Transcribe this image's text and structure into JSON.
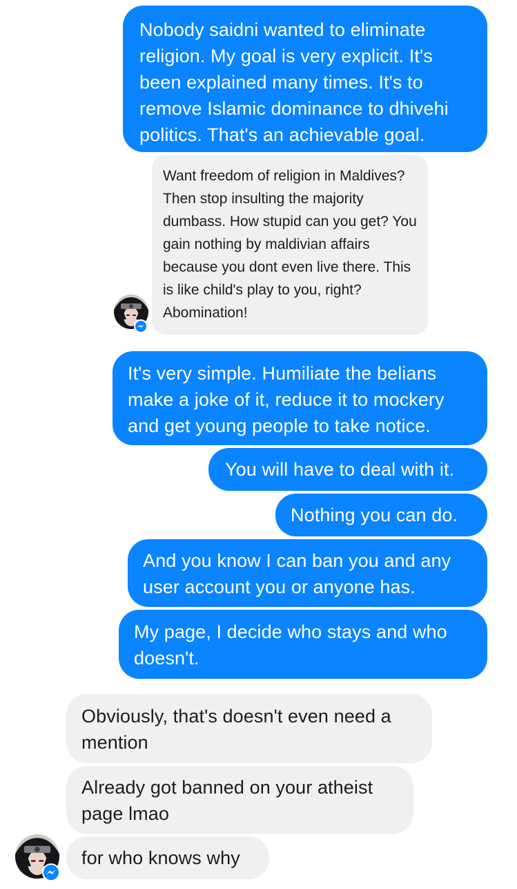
{
  "conversation": {
    "messages": [
      {
        "sender": "me",
        "text": "Nobody saidni wanted to eliminate religion. My goal is very explicit. It's been explained many times. It's to remove Islamic dominance to dhivehi politics. That's an achievable goal."
      },
      {
        "sender": "other",
        "type": "quoted-image",
        "text": "Want freedom of religion in Maldives? Then stop insulting the majority dumbass. How stupid can you get? You gain nothing by maldivian affairs because you dont even live there. This is like child's play to you, right? Abomination!"
      },
      {
        "sender": "me",
        "text": "It's very simple. Humiliate the belians make a joke of it, reduce it to mockery and get young people to take notice."
      },
      {
        "sender": "me",
        "text": "You will have to deal with it."
      },
      {
        "sender": "me",
        "text": "Nothing you can do."
      },
      {
        "sender": "me",
        "text": "And you know I can ban you and any user account you or anyone has."
      },
      {
        "sender": "me",
        "text": "My page, I decide who stays and who doesn't."
      },
      {
        "sender": "other",
        "text": "Obviously, that's doesn't even need a mention"
      },
      {
        "sender": "other",
        "text": "Already got banned on your atheist page lmao"
      },
      {
        "sender": "other",
        "text": "for who knows why"
      }
    ]
  },
  "avatar": {
    "icon": "anime-avatar-icon",
    "badge_icon": "messenger-badge-icon"
  },
  "colors": {
    "outgoing_bubble": "#0a84ff",
    "incoming_bubble": "#f0f0f0",
    "outgoing_text": "#ffffff",
    "incoming_text": "#1c1c1c"
  }
}
